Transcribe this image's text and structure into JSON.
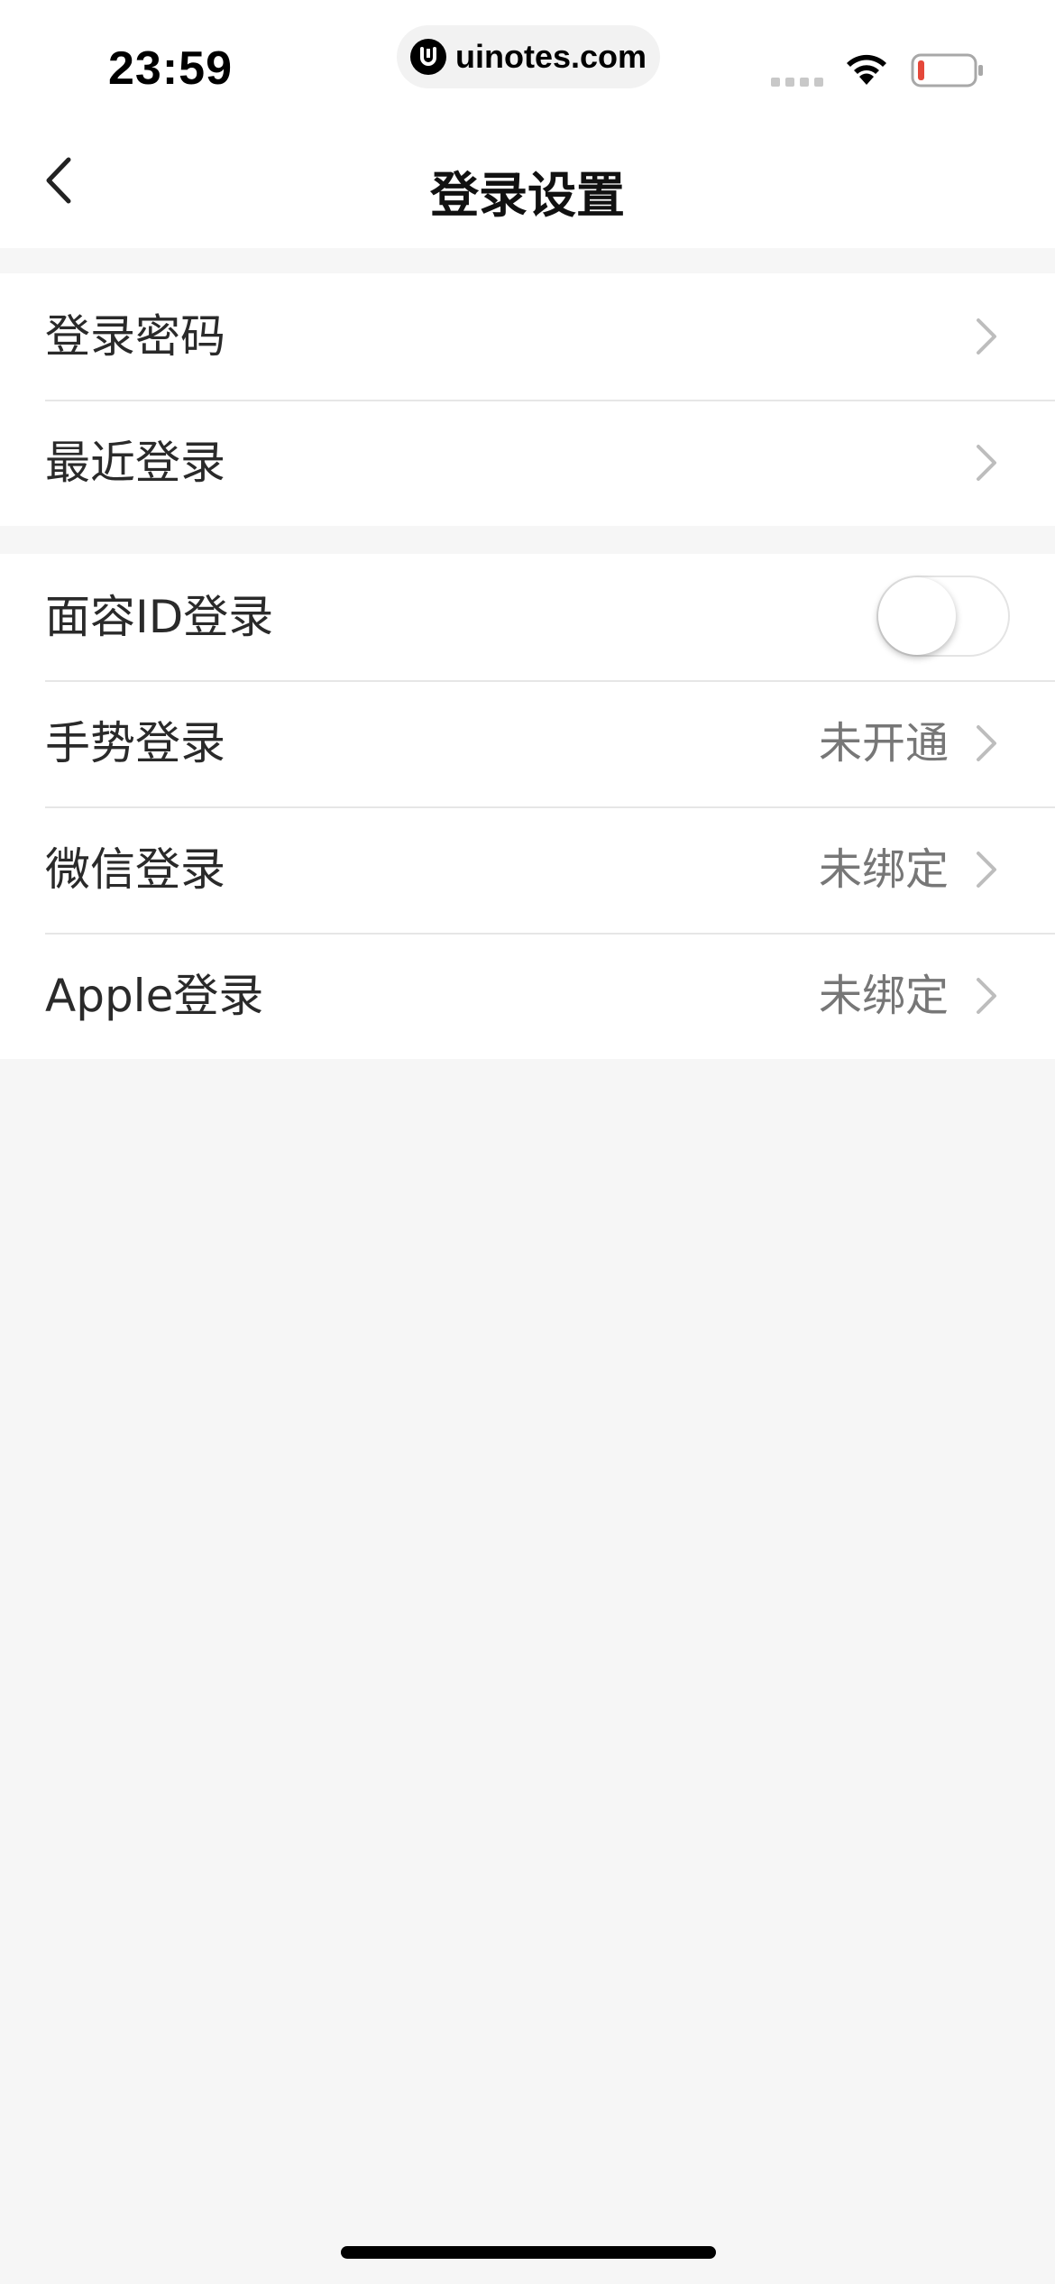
{
  "status_bar": {
    "time": "23:59",
    "url": "uinotes.com",
    "battery_color": "#e5483a"
  },
  "nav": {
    "title": "登录设置",
    "back_icon": "chevron-left-icon"
  },
  "group_1": [
    {
      "label": "登录密码",
      "value": ""
    },
    {
      "label": "最近登录",
      "value": ""
    }
  ],
  "group_2": {
    "face_id": {
      "label": "面容ID登录",
      "enabled": false
    },
    "gesture": {
      "label": "手势登录",
      "value": "未开通"
    },
    "wechat": {
      "label": "微信登录",
      "value": "未绑定"
    },
    "apple": {
      "label": "Apple登录",
      "value": "未绑定"
    }
  },
  "colors": {
    "background": "#f6f6f6",
    "card": "#ffffff",
    "divider": "#e6e6e6",
    "value_text": "#777777"
  }
}
